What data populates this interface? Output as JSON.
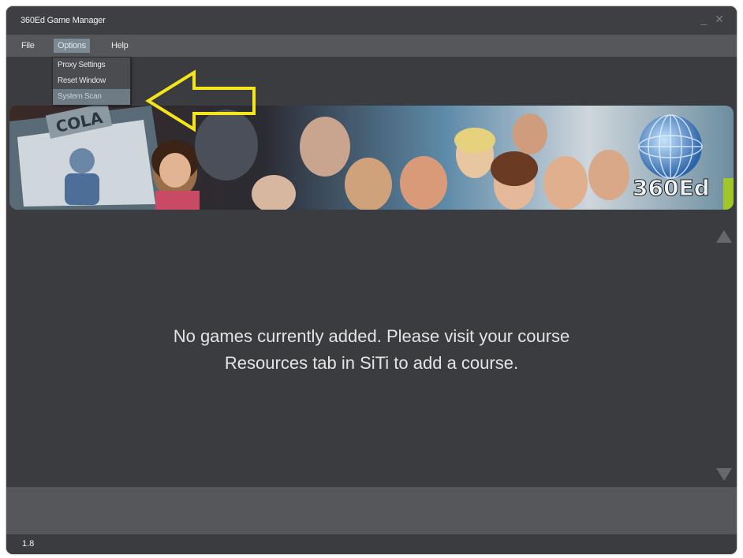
{
  "window": {
    "title": "360Ed Game Manager",
    "minimize_glyph": "_",
    "close_glyph": "✕"
  },
  "menubar": {
    "items": [
      {
        "label": "File"
      },
      {
        "label": "Options"
      },
      {
        "label": "Help"
      }
    ]
  },
  "options_menu": {
    "items": [
      {
        "label": "Proxy Settings"
      },
      {
        "label": "Reset Window"
      },
      {
        "label": "System Scan"
      }
    ],
    "highlighted": "System Scan"
  },
  "annotation": {
    "icon": "left-arrow-icon",
    "color": "#f5e61b"
  },
  "banner": {
    "logo_text": "360Ed",
    "sign_text": "COLA"
  },
  "main": {
    "empty_line1": "No games currently added.  Please visit your course",
    "empty_line2": "Resources tab in SiTi to add a course."
  },
  "status": {
    "version": "1.8"
  },
  "colors": {
    "window_bg": "#3a3c3f",
    "menubar_bg": "#55575a",
    "menu_highlight": "#7c8a95",
    "text": "#e4e4e4"
  }
}
